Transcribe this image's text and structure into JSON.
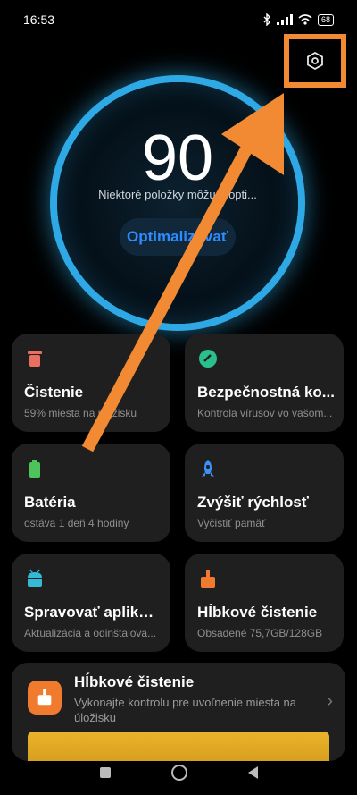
{
  "status_bar": {
    "time": "16:53",
    "battery": "68"
  },
  "score": {
    "value": "90",
    "subtitle": "Niektoré položky môžu... opti...",
    "action_label": "Optimalizovať"
  },
  "cards": [
    {
      "title": "Čistenie",
      "subtitle": "59% miesta na úložisku",
      "icon": "trash-icon",
      "color": "#e96f60"
    },
    {
      "title": "Bezpečnostná ko...",
      "subtitle": "Kontrola vírusov vo vašom...",
      "icon": "shield-check-icon",
      "color": "#2bbf8f"
    },
    {
      "title": "Batéria",
      "subtitle": "ostáva 1 deň 4 hodiny",
      "icon": "battery-icon",
      "color": "#4cc35b"
    },
    {
      "title": "Zvýšiť rýchlosť",
      "subtitle": "Vyčistiť pamäť",
      "icon": "rocket-icon",
      "color": "#3d8ff5"
    },
    {
      "title": "Spravovať aplikácie",
      "subtitle": "Aktualizácia a odinštalova...",
      "icon": "android-icon",
      "color": "#34b9d6"
    },
    {
      "title": "Hĺbkové čistenie",
      "subtitle": "Obsadené 75,7GB/128GB",
      "icon": "broom-icon",
      "color": "#f07a2e"
    }
  ],
  "banner": {
    "title": "Hĺbkové čistenie",
    "description": "Vykonajte kontrolu pre uvoľnenie miesta na úložisku",
    "icon": "broom-icon"
  },
  "colors": {
    "accent": "#2fa9e6",
    "highlight": "#f28a33"
  }
}
